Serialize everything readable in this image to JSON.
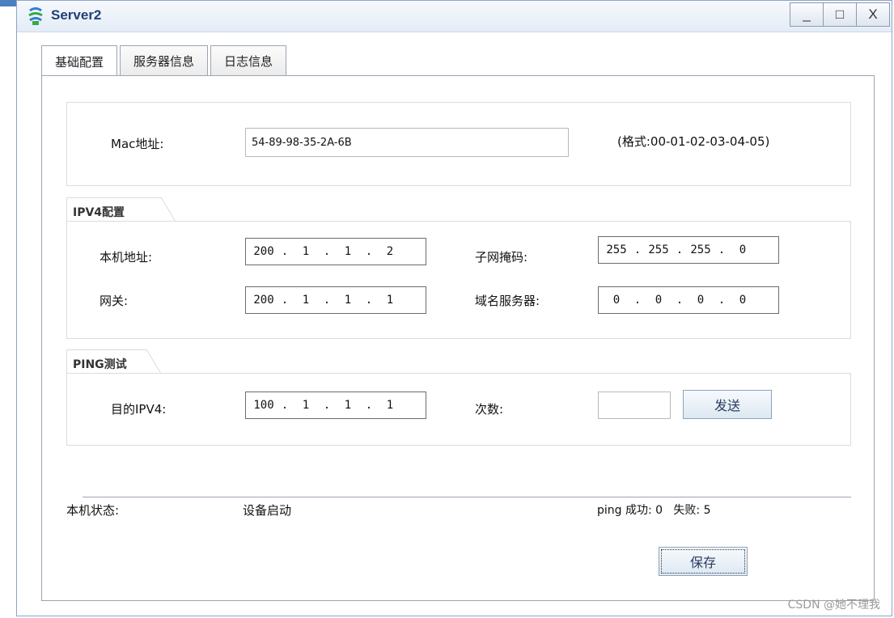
{
  "window": {
    "title": "Server2",
    "controls": {
      "minimize": "_",
      "maximize": "□",
      "close": "X"
    }
  },
  "tabs": [
    {
      "label": "基础配置",
      "active": true
    },
    {
      "label": "服务器信息",
      "active": false
    },
    {
      "label": "日志信息",
      "active": false
    }
  ],
  "mac": {
    "label": "Mac地址:",
    "value": "54-89-98-35-2A-6B",
    "hint": "(格式:00-01-02-03-04-05)"
  },
  "ipv4": {
    "title": "IPV4配置",
    "local_label": "本机地址:",
    "local": [
      "200",
      "1",
      "1",
      "2"
    ],
    "mask_label": "子网掩码:",
    "mask": [
      "255",
      "255",
      "255",
      "0"
    ],
    "gateway_label": "网关:",
    "gateway": [
      "200",
      "1",
      "1",
      "1"
    ],
    "dns_label": "域名服务器:",
    "dns": [
      "0",
      "0",
      "0",
      "0"
    ]
  },
  "ping": {
    "title": "PING测试",
    "dest_label": "目的IPV4:",
    "dest": [
      "100",
      "1",
      "1",
      "1"
    ],
    "count_label": "次数:",
    "count_value": "",
    "send_label": "发送"
  },
  "status": {
    "label": "本机状态:",
    "value": "设备启动",
    "ping_result": "ping 成功: 0   失败: 5"
  },
  "save_label": "保存",
  "watermark": "CSDN @她不理我",
  "colors": {
    "title_text": "#1f3f78",
    "button_text": "#2a3c5e"
  }
}
